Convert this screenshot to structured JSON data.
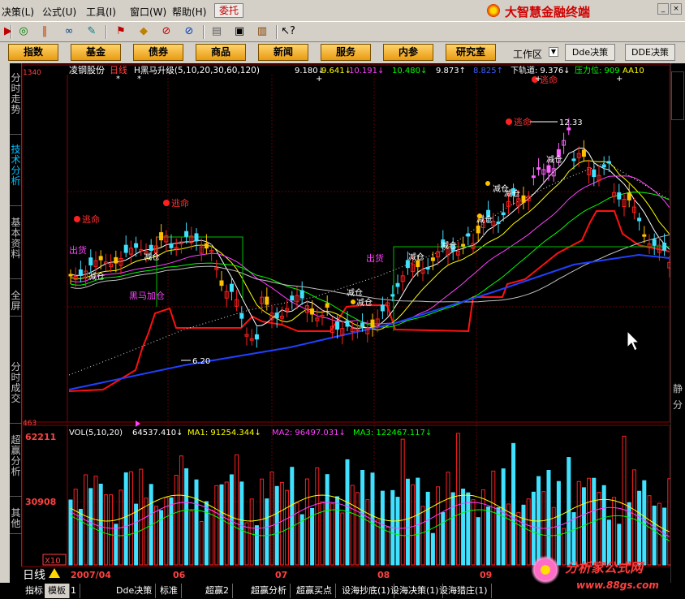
{
  "menubar": {
    "items": [
      "决策(L)",
      "公式(U)",
      "工具(I)",
      "窗口(W)",
      "帮助(H)"
    ],
    "weituo": "委托",
    "brand": "大智慧金融终端"
  },
  "navbar": {
    "tabs": [
      "指数",
      "基金",
      "债券",
      "商品",
      "新闻",
      "服务",
      "内参",
      "研究室"
    ],
    "workarea": "工作区",
    "dde1": "Dde决策",
    "dde2": "DDE决策"
  },
  "sidetabs": [
    "分时走势",
    "技术分析",
    "基本资料",
    "全屏",
    "分时成交",
    "超赢分析",
    "其他"
  ],
  "chart_header": {
    "stock": "凌钢股份",
    "period": "日线",
    "indicator": "H黑马升级(5,10,20,30,60,120)",
    "vals": [
      {
        "text": "9.180↓",
        "color": "#ffffff"
      },
      {
        "text": "9.641↓",
        "color": "#ffff00"
      },
      {
        "text": "10.191↓",
        "color": "#ff40ff"
      },
      {
        "text": "10.480↓",
        "color": "#00ff00"
      },
      {
        "text": "9.873↑",
        "color": "#ffffff"
      },
      {
        "text": "8.825↑",
        "color": "#4060ff"
      },
      {
        "text": "下轨道: 9.376↓",
        "color": "#ffffff"
      },
      {
        "text": "压力位: 909",
        "color": "#00ff00"
      },
      {
        "text": "AA10",
        "color": "#ffff00"
      }
    ]
  },
  "price_axis": {
    "top": "1340",
    "bottom": "463"
  },
  "price_labels": {
    "high": "12.33",
    "low": "6.20"
  },
  "annotations": {
    "taoming": "逃命",
    "chuhuo": "出货",
    "jiancang": "减仓",
    "heima": "黑马加仓"
  },
  "vol_header": {
    "name": "VOL(5,10,20)",
    "vals": [
      {
        "text": "64537.410↓",
        "color": "#ffffff"
      },
      {
        "text": "MA1: 91254.344↓",
        "color": "#ffff00"
      },
      {
        "text": "MA2: 96497.031↓",
        "color": "#ff40ff"
      },
      {
        "text": "MA3: 122467.117↓",
        "color": "#00ff00"
      }
    ]
  },
  "vol_axis": {
    "top": "62211",
    "mid": "30908",
    "unit": "X10"
  },
  "date_axis": [
    "2007/04",
    "06",
    "07",
    "08",
    "09"
  ],
  "bottom": {
    "dayline": "日线",
    "tabs": [
      "指标",
      "模板",
      "1",
      "Dde决策",
      "标准",
      "超赢2",
      "超赢分析",
      "超赢买点",
      "设海抄底(1)",
      "设海决策(1)",
      "设海猎庄(1)"
    ]
  },
  "right_edge_text": [
    "静",
    "分"
  ],
  "watermark": {
    "title": "分析家公式网",
    "url": "www.88gs.com"
  }
}
